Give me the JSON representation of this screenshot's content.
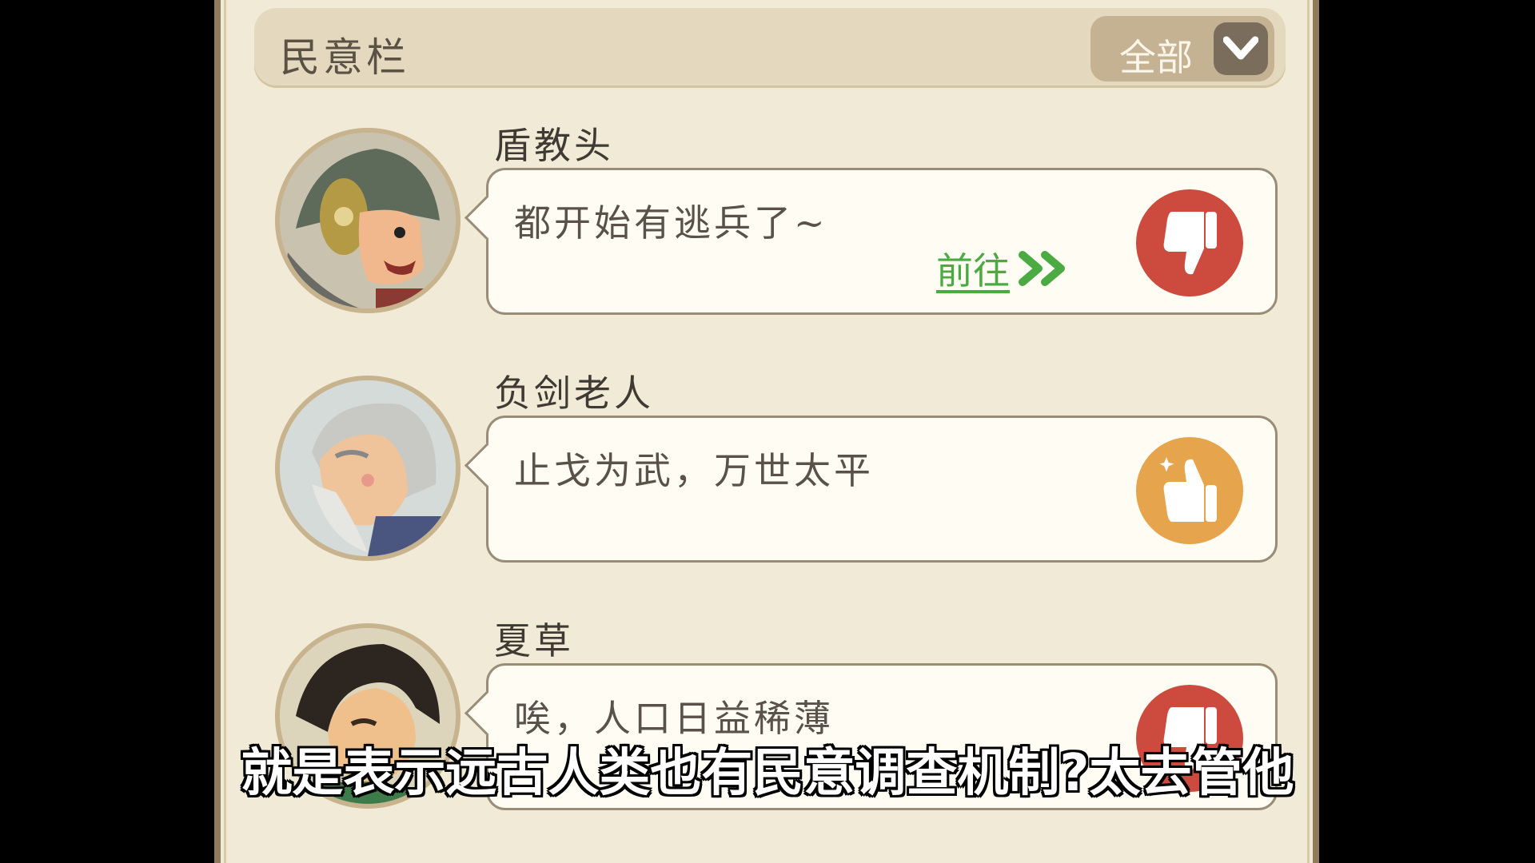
{
  "header": {
    "title": "民意栏",
    "filter_label": "全部"
  },
  "entries": [
    {
      "name": "盾教头",
      "message": "都开始有逃兵了~",
      "goto_label": "前往",
      "reaction": "thumbs-down",
      "reaction_color": "#cc4a3e"
    },
    {
      "name": "负剑老人",
      "message": "止戈为武，万世太平",
      "reaction": "thumbs-up",
      "reaction_color": "#e6a44c"
    },
    {
      "name": "夏草",
      "message": "唉，人口日益稀薄",
      "reaction": "thumbs-down",
      "reaction_color": "#cc4a3e"
    }
  ],
  "subtitle": "就是表示远古人类也有民意调查机制?太去管他",
  "colors": {
    "panel": "#f1ead6",
    "goto_green": "#4caa43"
  }
}
